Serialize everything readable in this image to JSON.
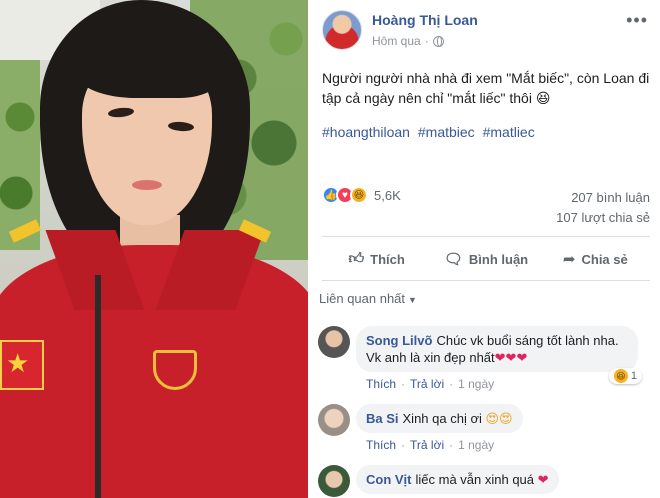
{
  "post": {
    "author": "Hoàng Thị Loan",
    "time": "Hôm qua",
    "caption": "Người người nhà nhà đi xem \"Mắt biếc\", còn Loan đi tập cả ngày nên chỉ \"mắt liếc\" thôi 😆",
    "hashtags": [
      "#hoangthiloan",
      "#matbiec",
      "#matliec"
    ],
    "reactions_count": "5,6K",
    "comments_count": "207 bình luận",
    "shares_count": "107 lượt chia sẻ"
  },
  "actions": {
    "like": "Thích",
    "comment": "Bình luận",
    "share": "Chia sẻ"
  },
  "comments_sort": "Liên quan nhất",
  "comments": [
    {
      "name": "Song Lilvõ",
      "text_line1": "Chúc vk buổi sáng tốt lành nha.",
      "text_line2": "Vk anh là xin đẹp nhất",
      "hearts": "❤❤❤",
      "like": "Thích",
      "reply": "Trả lời",
      "time": "1 ngày",
      "reaction_count": "1"
    },
    {
      "name": "Ba Si",
      "text": "Xinh qa chị ơi",
      "emoji": "😍😍",
      "like": "Thích",
      "reply": "Trả lời",
      "time": "1 ngày"
    },
    {
      "name": "Con Vịt",
      "text": "liếc mà vẫn xinh quá",
      "hearts": "❤"
    }
  ],
  "icons": {
    "more": "more-icon",
    "globe": "globe-icon",
    "like": "thumbs-up-icon",
    "comment": "comment-icon",
    "share": "share-icon"
  },
  "colors": {
    "link": "#385898",
    "muted": "#606770",
    "bubble": "#f2f3f5",
    "like_blue": "#2d88ff",
    "love_red": "#f33e58",
    "haha_yellow": "#f7b125"
  }
}
